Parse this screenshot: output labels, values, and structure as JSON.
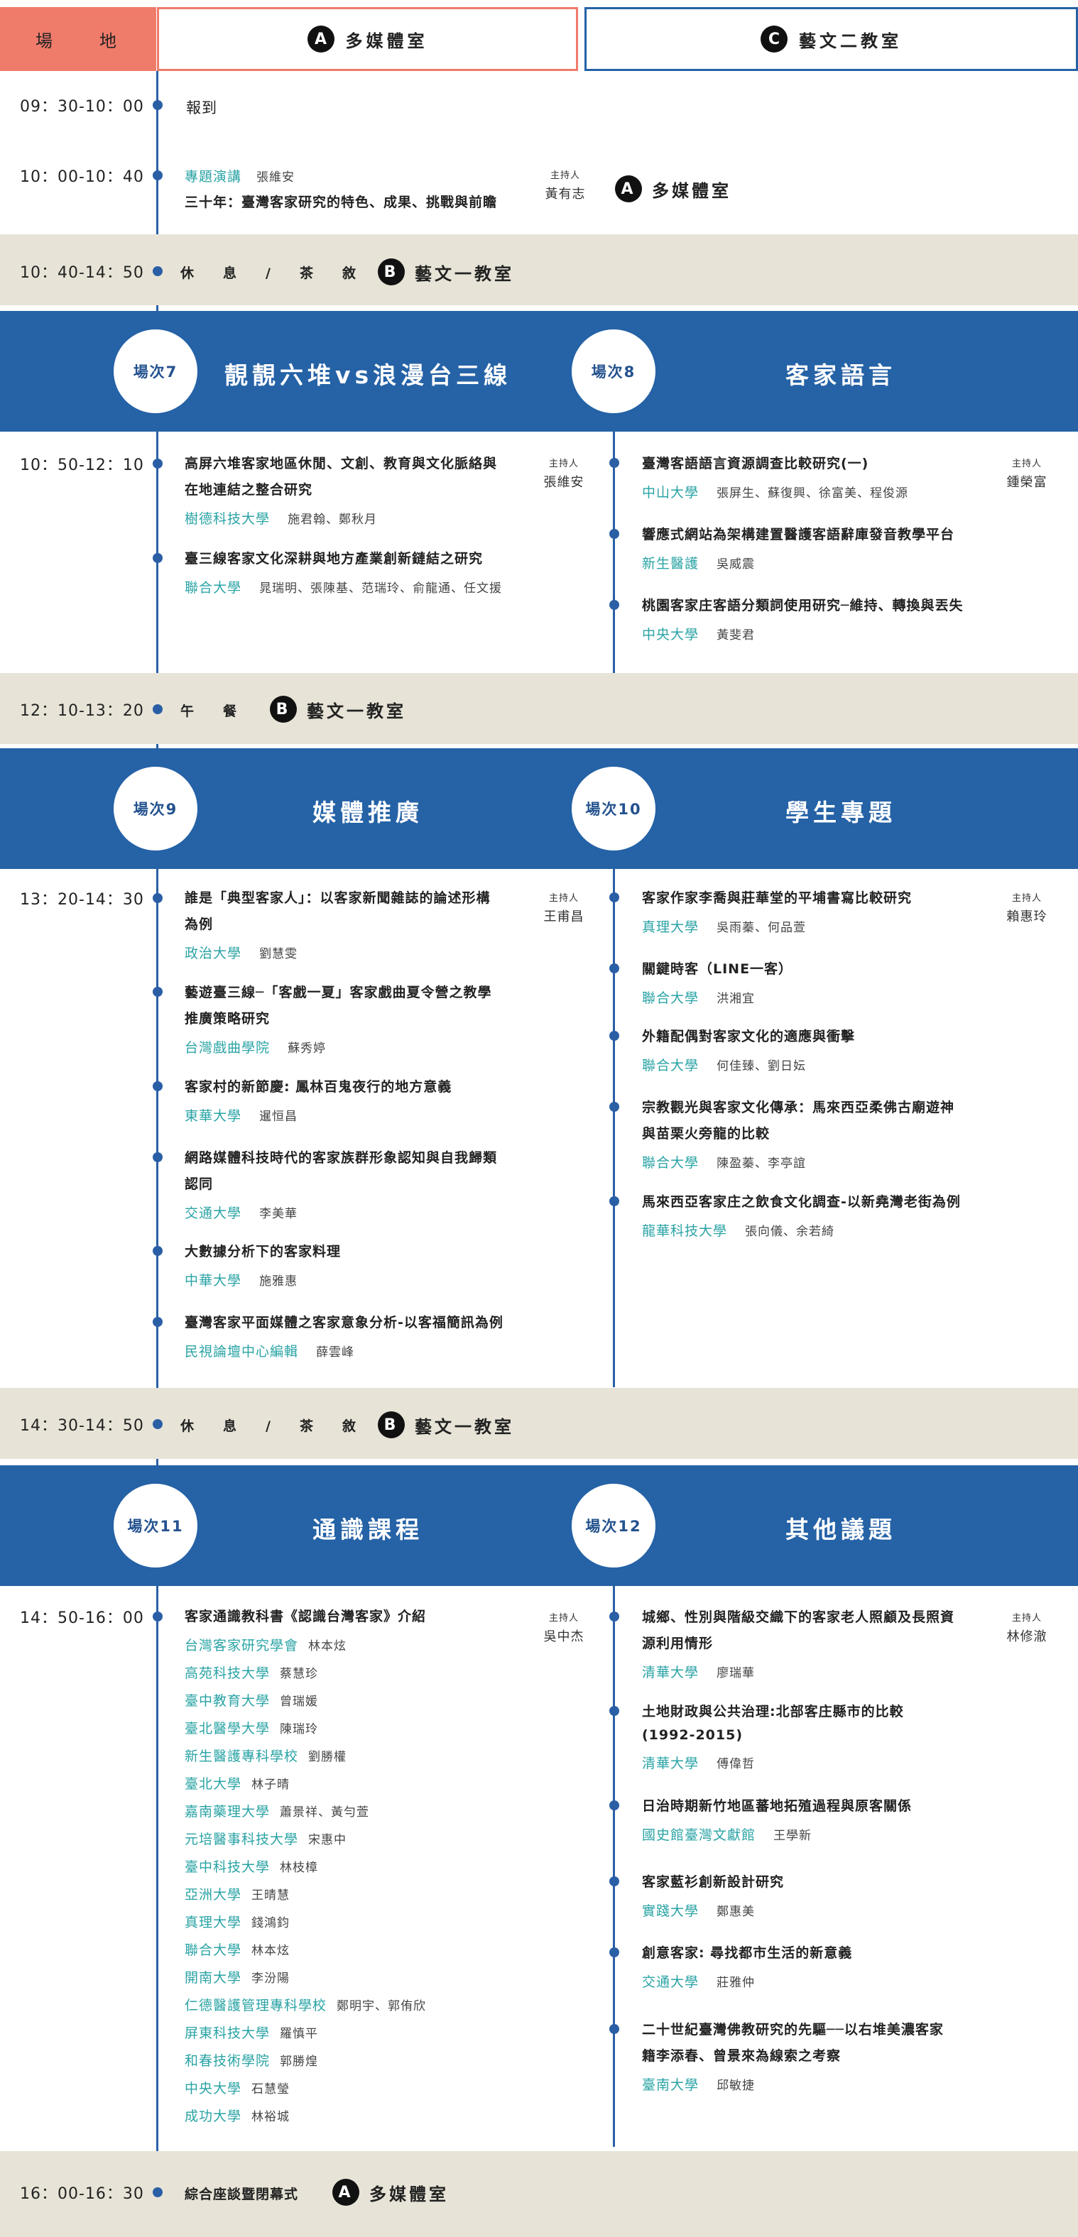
{
  "header": {
    "venue_label": "場　　地",
    "room_a_badge": "A",
    "room_a_name": "多媒體室",
    "room_c_badge": "C",
    "room_c_name": "藝文二教室"
  },
  "colors": {
    "salmon": "#ef7b6b",
    "blue": "#2562a6",
    "teal": "#2aa3a5",
    "band": "#e7e4d7"
  },
  "schedule": {
    "s1": {
      "time": "09：30-10：00",
      "label": "報到"
    },
    "s2": {
      "time": "10：00-10：40",
      "tag": "專題演講",
      "speaker": "張維安",
      "title": "三十年：臺灣客家研究的特色、成果、挑戰與前瞻",
      "host_label": "主持人",
      "host": "黃有志",
      "room_badge": "A",
      "room_name": "多媒體室"
    },
    "s3": {
      "time": "10：40-14：50",
      "label": "休　　息　　/　　茶　　敘",
      "room_badge": "B",
      "room_name": "藝文一教室"
    },
    "s4": {
      "time": "12：10-13：20",
      "label": "午　　餐",
      "room_badge": "B",
      "room_name": "藝文一教室"
    },
    "s5": {
      "time": "14：30-14：50",
      "label": "休　　息　　/　　茶　　敘",
      "room_badge": "B",
      "room_name": "藝文一教室"
    },
    "s6": {
      "time": "16：00-16：30",
      "label": "綜合座談暨閉幕式",
      "room_badge": "A",
      "room_name": "多媒體室"
    }
  },
  "sessions": {
    "r1": {
      "left_no": "場次7",
      "left_title": "靚靚六堆vs浪漫台三線",
      "right_no": "場次8",
      "right_title": "客家語言",
      "time": "10：50-12：10",
      "left_host_label": "主持人",
      "left_host": "張維安",
      "right_host_label": "主持人",
      "right_host": "鍾榮富",
      "left_items": [
        {
          "t1": "高屏六堆客家地區休閒、文創、教育與文化脈絡與",
          "t2": "在地連結之整合研究",
          "org": "樹德科技大學",
          "auth": "施君翰、鄭秋月"
        },
        {
          "t1": "臺三線客家文化深耕與地方產業創新鏈結之研究",
          "t2": "",
          "org": "聯合大學",
          "auth": "晁瑞明、張陳基、范瑞玲、俞龍通、任文援"
        }
      ],
      "right_items": [
        {
          "t1": "臺灣客語語言資源調查比較研究(一)",
          "org": "中山大學",
          "auth": "張屏生、蘇復興、徐富美、程俊源"
        },
        {
          "t1": "響應式網站為架構建置醫護客語辭庫發音教學平台",
          "org": "新生醫護",
          "auth": "吳威震"
        },
        {
          "t1": "桃園客家庄客語分類詞使用研究─維持、轉換與丟失",
          "org": "中央大學",
          "auth": "黃斐君"
        }
      ]
    },
    "r2": {
      "left_no": "場次9",
      "left_title": "媒體推廣",
      "right_no": "場次10",
      "right_title": "學生專題",
      "time": "13：20-14：30",
      "left_host_label": "主持人",
      "left_host": "王甫昌",
      "right_host_label": "主持人",
      "right_host": "賴惠玲",
      "left_items": [
        {
          "t1": "誰是「典型客家人」：以客家新聞雜誌的論述形構",
          "t2": "為例",
          "org": "政治大學",
          "auth": "劉慧雯"
        },
        {
          "t1": "藝遊臺三線─「客戲一夏」客家戲曲夏令營之教學",
          "t2": "推廣策略研究",
          "org": "台灣戲曲學院",
          "auth": "蘇秀婷"
        },
        {
          "t1": "客家村的新節慶: 鳳林百鬼夜行的地方意義",
          "t2": "",
          "org": "東華大學",
          "auth": "暹恒昌"
        },
        {
          "t1": "網路媒體科技時代的客家族群形象認知與自我歸類",
          "t2": "認同",
          "org": "交通大學",
          "auth": "李美華"
        },
        {
          "t1": "大數據分析下的客家料理",
          "t2": "",
          "org": "中華大學",
          "auth": "施雅惠"
        },
        {
          "t1": "臺灣客家平面媒體之客家意象分析-以客福簡訊為例",
          "t2": "",
          "org": "民視論壇中心編輯",
          "auth": "薛雲峰"
        }
      ],
      "right_items": [
        {
          "t1": "客家作家李喬與莊華堂的平埔書寫比較研究",
          "t2": "",
          "org": "真理大學",
          "auth": "吳雨蓁、何品萱"
        },
        {
          "t1": "關鍵時客（LINE一客）",
          "t2": "",
          "org": "聯合大學",
          "auth": "洪湘宜"
        },
        {
          "t1": "外籍配偶對客家文化的適應與衝擊",
          "t2": "",
          "org": "聯合大學",
          "auth": "何佳臻、劉日妘"
        },
        {
          "t1": "宗教觀光與客家文化傳承：馬來西亞柔佛古廟遊神",
          "t2": "與苗栗火旁龍的比較",
          "org": "聯合大學",
          "auth": "陳盈蓁、李亭誼"
        },
        {
          "t1": "馬來西亞客家庄之飲食文化調查-以新堯灣老街為例",
          "t2": "",
          "org": "龍華科技大學",
          "auth": "張向儀、余若綺"
        }
      ]
    },
    "r3": {
      "left_no": "場次11",
      "left_title": "通識課程",
      "right_no": "場次12",
      "right_title": "其他議題",
      "time": "14：50-16：00",
      "left_host_label": "主持人",
      "left_host": "吳中杰",
      "right_host_label": "主持人",
      "right_host": "林修澈",
      "left_title_item": "客家通識教科書《認識台灣客家》介紹",
      "left_list": [
        {
          "org": "台灣客家研究學會",
          "auth": "林本炫"
        },
        {
          "org": "高苑科技大學",
          "auth": "蔡慧珍"
        },
        {
          "org": "臺中教育大學",
          "auth": "曾瑞媛"
        },
        {
          "org": "臺北醫學大學",
          "auth": "陳瑞玲"
        },
        {
          "org": "新生醫護專科學校",
          "auth": "劉勝權"
        },
        {
          "org": "臺北大學",
          "auth": "林子晴"
        },
        {
          "org": "嘉南藥理大學",
          "auth": "蕭景祥、黃勻萱"
        },
        {
          "org": "元培醫事科技大學",
          "auth": "宋惠中"
        },
        {
          "org": "臺中科技大學",
          "auth": "林枝樟"
        },
        {
          "org": "亞洲大學",
          "auth": "王晴慧"
        },
        {
          "org": "真理大學",
          "auth": "錢鴻鈞"
        },
        {
          "org": "聯合大學",
          "auth": "林本炫"
        },
        {
          "org": "開南大學",
          "auth": "李汾陽"
        },
        {
          "org": "仁德醫護管理專科學校",
          "auth": "鄭明宇、郭侑欣"
        },
        {
          "org": "屏東科技大學",
          "auth": "羅慎平"
        },
        {
          "org": "和春技術學院",
          "auth": "郭勝煌"
        },
        {
          "org": "中央大學",
          "auth": "石慧瑩"
        },
        {
          "org": "成功大學",
          "auth": "林裕城"
        }
      ],
      "right_items": [
        {
          "t1": "城鄉、性別與階級交織下的客家老人照顧及長照資",
          "t2": "源利用情形",
          "org": "清華大學",
          "auth": "廖瑞華"
        },
        {
          "t1": "土地財政與公共治理:北部客庄縣市的比較",
          "t2": "(1992-2015)",
          "org": "清華大學",
          "auth": "傅偉哲"
        },
        {
          "t1": "日治時期新竹地區蕃地拓殖過程與原客關係",
          "t2": "",
          "org": "國史館臺灣文獻館",
          "auth": "王學新"
        },
        {
          "t1": "客家藍衫創新設計研究",
          "t2": "",
          "org": "實踐大學",
          "auth": "鄭惠美"
        },
        {
          "t1": "創意客家: 尋找都市生活的新意義",
          "t2": "",
          "org": "交通大學",
          "auth": "莊雅仲"
        },
        {
          "t1": "二十世紀臺灣佛教研究的先驅──以右堆美濃客家",
          "t2": "籍李添春、曾景來為線索之考察",
          "org": "臺南大學",
          "auth": "邱敏捷"
        }
      ]
    }
  }
}
